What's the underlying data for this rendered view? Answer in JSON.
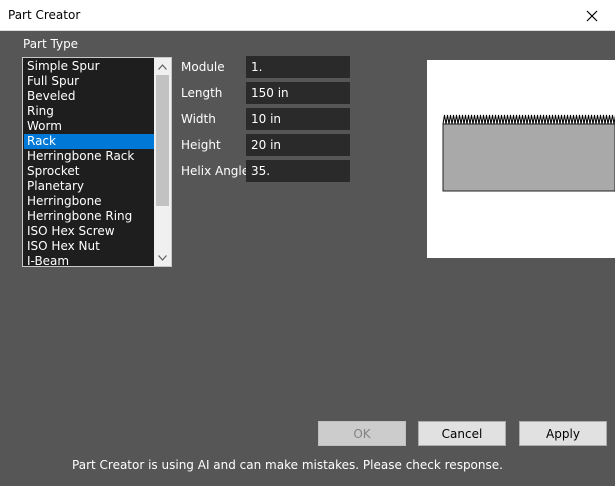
{
  "window": {
    "title": "Part Creator",
    "close_icon": "close-icon"
  },
  "part_type": {
    "label": "Part Type",
    "items": [
      "Simple Spur",
      "Full Spur",
      "Beveled",
      "Ring",
      "Worm",
      "Rack",
      "Herringbone Rack",
      "Sprocket",
      "Planetary",
      "Herringbone",
      "Herringbone Ring",
      "ISO Hex Screw",
      "ISO Hex Nut",
      "I-Beam"
    ],
    "selected": "Rack"
  },
  "fields": {
    "module": {
      "label": "Module",
      "value": "1."
    },
    "length": {
      "label": "Length",
      "value": "150 in"
    },
    "width": {
      "label": "Width",
      "value": "10 in"
    },
    "height": {
      "label": "Height",
      "value": "20 in"
    },
    "helix_angle": {
      "label": "Helix Angle",
      "value": "35."
    }
  },
  "buttons": {
    "ok": "OK",
    "cancel": "Cancel",
    "apply": "Apply"
  },
  "disclaimer": "Part Creator is using AI and can make mistakes. Please check response.",
  "colors": {
    "background": "#565656",
    "list_background": "#1e1e1e",
    "selection": "#0078d7",
    "field_background": "#2a2a2a",
    "preview_background": "#ffffff",
    "rack_fill": "#a9a9a9"
  }
}
